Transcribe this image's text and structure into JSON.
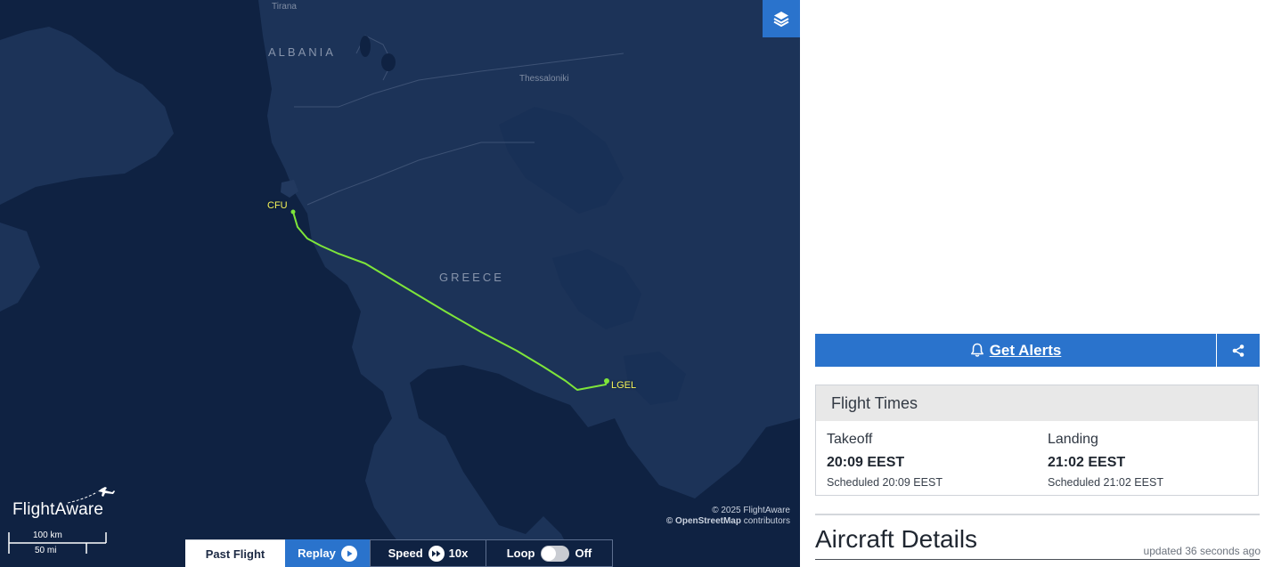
{
  "map": {
    "country_labels": [
      "ALBANIA",
      "GREECE"
    ],
    "city_labels": [
      "Tirana",
      "Thessaloniki"
    ],
    "airports": {
      "origin": "CFU",
      "destination": "LGEL"
    },
    "route_color": "#7ee53a",
    "logo_text": "FlightAware",
    "scale": {
      "km": "100 km",
      "mi": "50 mi"
    },
    "attribution": {
      "line1": "© 2025 FlightAware",
      "line2_bold": "© OpenStreetMap",
      "line2_rest": " contributors"
    },
    "layers_icon": "layers-icon"
  },
  "controls": {
    "past_flight": "Past Flight",
    "replay": "Replay",
    "speed_label": "Speed",
    "speed_value": "10x",
    "loop_label": "Loop",
    "loop_value": "Off"
  },
  "alerts": {
    "label": "Get Alerts",
    "icon": "bell-icon",
    "share_icon": "share-icon"
  },
  "flight_times": {
    "title": "Flight Times",
    "takeoff": {
      "label": "Takeoff",
      "time": "20:09 EEST",
      "scheduled": "Scheduled 20:09 EEST"
    },
    "landing": {
      "label": "Landing",
      "time": "21:02 EEST",
      "scheduled": "Scheduled 21:02 EEST"
    }
  },
  "aircraft_details": {
    "title": "Aircraft Details",
    "updated": "updated 36 seconds ago"
  },
  "colors": {
    "accent": "#2a73cc",
    "map_sea": "#0f2242",
    "map_land": "#1c3358",
    "airport_label": "#f6f45a"
  }
}
